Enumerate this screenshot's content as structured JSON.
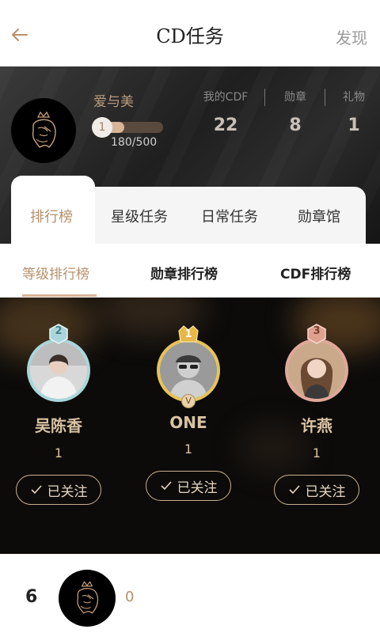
{
  "nav": {
    "title": "CD任务",
    "right_link": "发现"
  },
  "profile": {
    "name": "爱与美",
    "level": "1",
    "progress_text": "180/500",
    "progress_fraction": 0.36,
    "stats": [
      {
        "label": "我的CDF",
        "value": "22"
      },
      {
        "label": "勋章",
        "value": "8"
      },
      {
        "label": "礼物",
        "value": "1"
      }
    ]
  },
  "main_tabs": [
    "排行榜",
    "星级任务",
    "日常任务",
    "勋章馆"
  ],
  "sub_tabs": [
    "等级排行榜",
    "勋章排行榜",
    "CDF排行榜"
  ],
  "podium": [
    {
      "rank": "2",
      "name": "吴陈香",
      "score": "1",
      "follow": "已关注",
      "ring": "#a9d6da",
      "badge": "#a9d6da"
    },
    {
      "rank": "1",
      "name": "ONE",
      "score": "1",
      "follow": "已关注",
      "ring": "#e6c35a",
      "badge": "#e6b846",
      "verified": "V"
    },
    {
      "rank": "3",
      "name": "许燕",
      "score": "1",
      "follow": "已关注",
      "ring": "#e0a89a",
      "badge": "#e0a08e"
    }
  ],
  "list": [
    {
      "rank": "6",
      "score": "0"
    }
  ],
  "colors": {
    "accent": "#b8906a",
    "gold": "#d9c3a3",
    "dark_bg": "#0c0b0a"
  }
}
